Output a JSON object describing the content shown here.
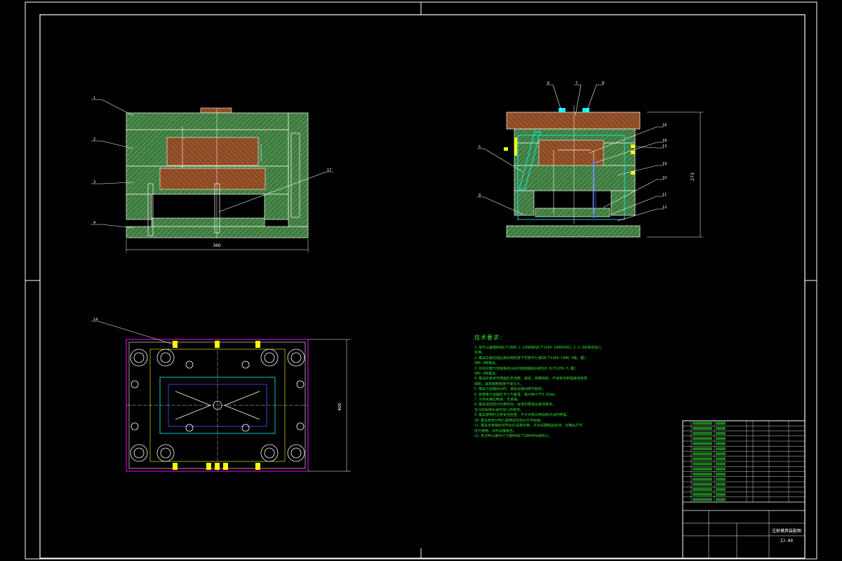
{
  "balloons": {
    "front": [
      "1",
      "2",
      "3",
      "4",
      "17"
    ],
    "side": [
      "6",
      "7",
      "8",
      "5",
      "16",
      "9",
      "18",
      "19",
      "10",
      "11",
      "12",
      "13"
    ],
    "plan": [
      "14"
    ]
  },
  "dimensions": {
    "front_width": "360",
    "side_height": "273",
    "plan_height": "400"
  },
  "tech_notes": {
    "title": "技术要求：",
    "lines": [
      "1.零件公差按照GB/T1800.1-1998和GB/T1184-1996中的1.1-1.5的规定执行",
      "  标准。",
      "2.模具总装完成后其所用的排下可按平行度GB/T1184-1996 5级。模/",
      "  GB8.3级模具。",
      "3.导柱导套与安装板处间间内侧面装配间隙在0.0/T1256-5,模/",
      "  GB4.3级模具。",
      "4.模具所有零件表面应无划痕，裂纹，锈等缺陷，不得有毛刺或其他杂质",
      "  缺陷，其表面粗糙度不得过大。",
      "5.模具分型面闭合时，其贴合面间隙不超标。",
      "6.各模板分型面应平行与垂直，其间隙小于0.02mm。",
      "7.冷却水路应畅通，无渗漏。",
      "8.模具成型部分应按实际，保证防腐蚀及其他要求。",
      "  在冷却系统水道中加入防锈剂。",
      "9.模具使用时注意安全检查，不允许有异响现象并及时修理。",
      "10.模具各部分用乙醇擦拭完全后方可组装。",
      "11.模具全部装配完毕后应试模合格，并对试模制品检测，合格后方可",
      "  交付使用，并附试模报告。",
      "12.未注明公差的尺寸按照GB/T1804中m级执行。"
    ]
  },
  "title_block": {
    "rows": 16,
    "drawing_name": "注射模具装配图",
    "drawing_number": "ZJ-00"
  },
  "colors": {
    "background": "#000000",
    "outline": "#ffffff",
    "plate_green": "#5fa85f",
    "plate_red": "#a0522d",
    "cyan": "#00ffff",
    "magenta": "#ff00ff",
    "yellow": "#ffff00",
    "blue": "#3a5fff",
    "text_green": "#2ee82e"
  }
}
